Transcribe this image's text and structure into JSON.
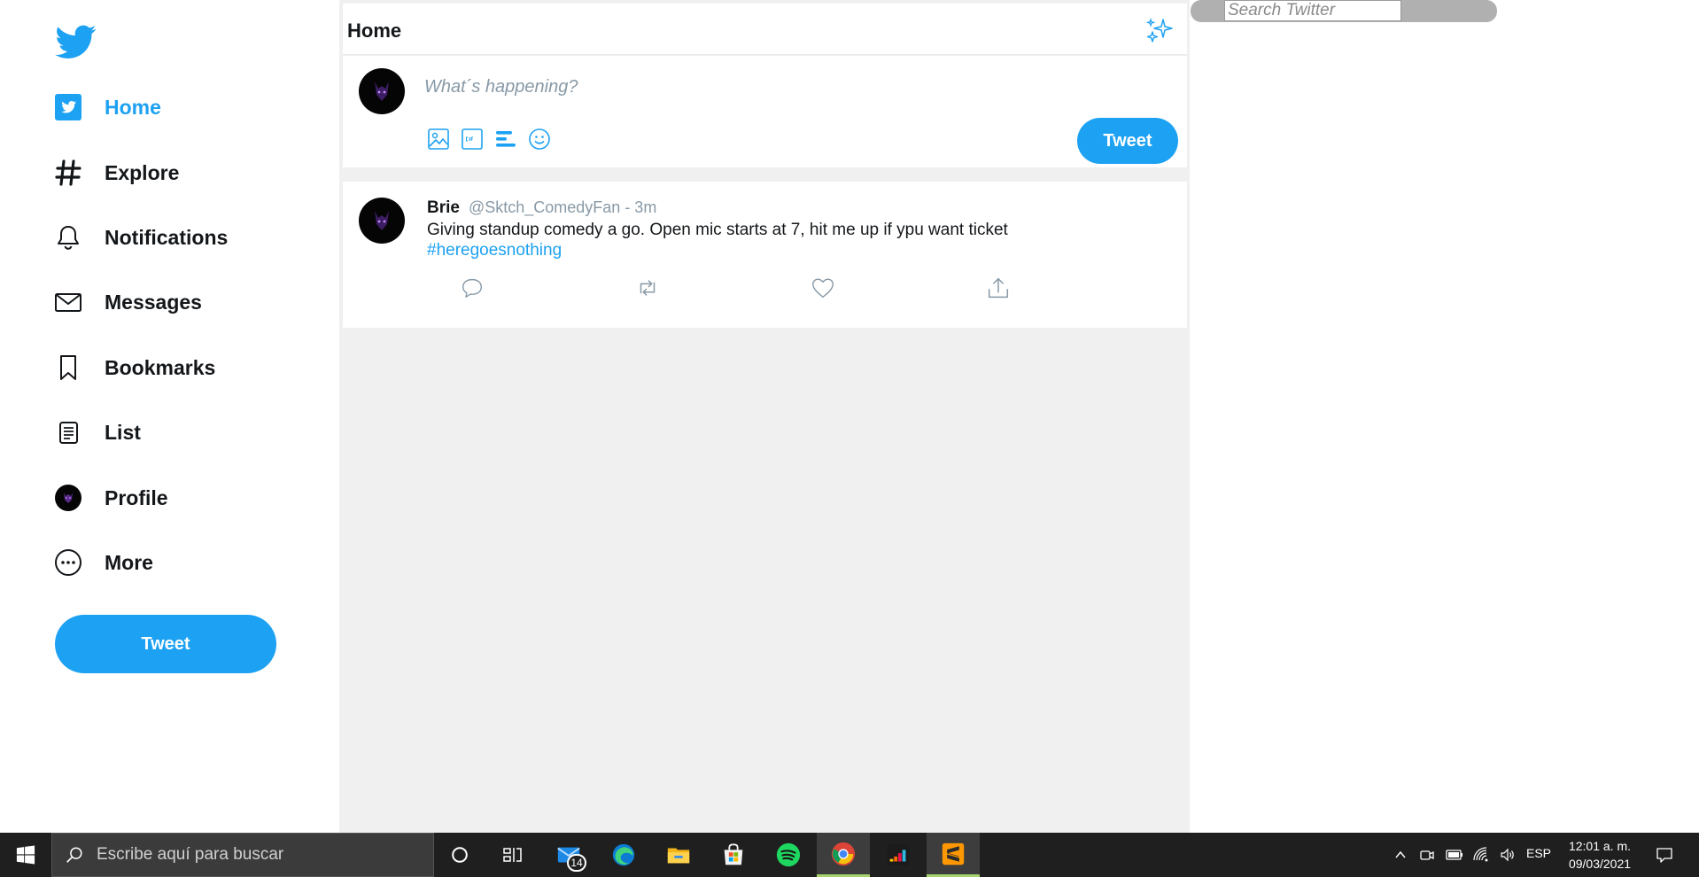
{
  "sidebar": {
    "items": [
      {
        "label": "Home",
        "icon": "home-icon"
      },
      {
        "label": "Explore",
        "icon": "hashtag-icon"
      },
      {
        "label": "Notifications",
        "icon": "bell-icon"
      },
      {
        "label": "Messages",
        "icon": "envelope-icon"
      },
      {
        "label": "Bookmarks",
        "icon": "bookmark-icon"
      },
      {
        "label": "List",
        "icon": "list-icon"
      },
      {
        "label": "Profile",
        "icon": "avatar-icon"
      },
      {
        "label": "More",
        "icon": "more-icon"
      }
    ],
    "tweet_button": "Tweet"
  },
  "header": {
    "title": "Home"
  },
  "composer": {
    "placeholder": "What´s happening?",
    "tweet_button": "Tweet"
  },
  "tweet": {
    "name": "Brie",
    "meta": "@Sktch_ComedyFan - 3m",
    "text": "Giving standup comedy a go. Open mic starts at 7, hit me up if ypu want ticket",
    "hashtag": "#heregoesnothing"
  },
  "search": {
    "placeholder": "Search Twitter"
  },
  "taskbar": {
    "search_placeholder": "Escribe aquí para buscar",
    "mail_badge": "14",
    "language": "ESP",
    "time": "12:01 a. m.",
    "date": "09/03/2021"
  },
  "colors": {
    "accent": "#1da1f2",
    "text": "#14171a",
    "muted": "#8899a6",
    "feed_bg": "#f0f0f0"
  }
}
